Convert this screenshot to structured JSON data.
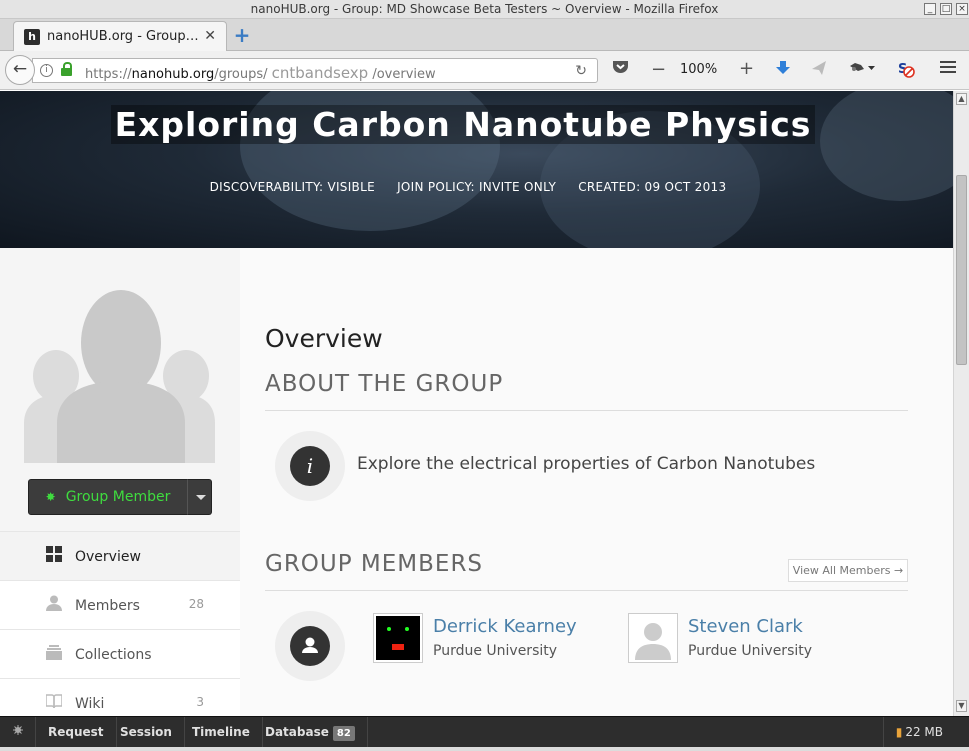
{
  "window": {
    "title": "nanoHUB.org - Group: MD Showcase Beta Testers ~ Overview - Mozilla Firefox"
  },
  "tabs": [
    {
      "label": "nanoHUB.org - Group…",
      "favicon": "h",
      "close": "✕"
    }
  ],
  "navbar": {
    "url_prefix": "https://",
    "url_host": "nanohub.org",
    "url_path": "/groups/",
    "url_group": "cntbandsexp",
    "url_rest": "/overview",
    "zoom": "100%"
  },
  "hero": {
    "title": "Exploring Carbon Nanotube Physics",
    "discoverability": "DISCOVERABILITY: VISIBLE",
    "join_policy": "JOIN POLICY: INVITE ONLY",
    "created": "CREATED: 09 OCT 2013"
  },
  "sidebar": {
    "member_button": "Group Member",
    "items": [
      {
        "label": "Overview",
        "count": "",
        "icon": "grid-icon"
      },
      {
        "label": "Members",
        "count": "28",
        "icon": "user-icon"
      },
      {
        "label": "Collections",
        "count": "",
        "icon": "collection-icon"
      },
      {
        "label": "Wiki",
        "count": "3",
        "icon": "book-icon"
      }
    ]
  },
  "main": {
    "heading": "Overview",
    "about_title": "ABOUT THE GROUP",
    "about_text": "Explore the electrical properties of Carbon Nanotubes",
    "members_title": "GROUP MEMBERS",
    "view_all": "View All Members →",
    "members": [
      {
        "name": "Derrick Kearney",
        "org": "Purdue University"
      },
      {
        "name": "Steven Clark",
        "org": "Purdue University"
      }
    ]
  },
  "debugbar": {
    "items": [
      "Request",
      "Session",
      "Timeline",
      "Database"
    ],
    "database_count": "82",
    "memory": "22 MB"
  },
  "colors": {
    "member_button_text": "#3fdc3f",
    "link": "#4a7fa8",
    "hero_bg": "#1f2a37"
  }
}
